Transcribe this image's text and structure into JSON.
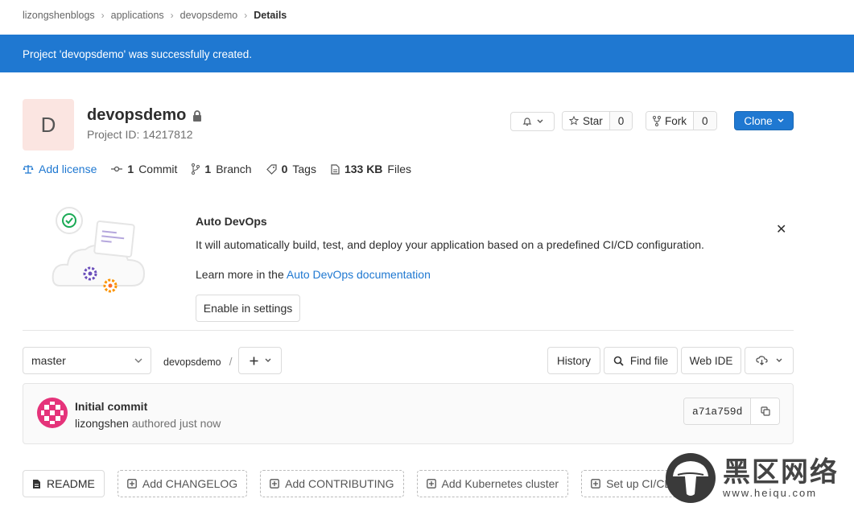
{
  "breadcrumb": {
    "items": [
      "lizongshenblogs",
      "applications",
      "devopsdemo"
    ],
    "current": "Details"
  },
  "flash": {
    "message": "Project 'devopsdemo' was successfully created."
  },
  "project": {
    "avatar_letter": "D",
    "name": "devopsdemo",
    "id_label": "Project ID: 14217812",
    "visibility_icon": "lock-icon"
  },
  "actions": {
    "star_label": "Star",
    "star_count": "0",
    "fork_label": "Fork",
    "fork_count": "0",
    "clone_label": "Clone"
  },
  "stats": {
    "add_license": "Add license",
    "commit_count": "1",
    "commit_label": "Commit",
    "branch_count": "1",
    "branch_label": "Branch",
    "tag_count": "0",
    "tag_label": "Tags",
    "files_size": "133 KB",
    "files_label": "Files"
  },
  "auto_devops": {
    "title": "Auto DevOps",
    "description": "It will automatically build, test, and deploy your application based on a predefined CI/CD configuration.",
    "learn_prefix": "Learn more in the ",
    "learn_link": "Auto DevOps documentation",
    "enable_button": "Enable in settings"
  },
  "tree": {
    "branch": "master",
    "path": "devopsdemo",
    "path_sep": "/",
    "history": "History",
    "find_file": "Find file",
    "web_ide": "Web IDE"
  },
  "commit": {
    "title": "Initial commit",
    "author": "lizongshen",
    "meta": "authored just now",
    "sha": "a71a759d"
  },
  "quick_actions": {
    "readme": "README",
    "changelog": "Add CHANGELOG",
    "contributing": "Add CONTRIBUTING",
    "kubernetes": "Add Kubernetes cluster",
    "cicd": "Set up CI/CD"
  },
  "watermark": {
    "title": "黑区网络",
    "url": "www.heiqu.com"
  },
  "colors": {
    "primary": "#1f78d1",
    "avatar_bg": "#fbe5e1",
    "border": "#dbdbdb"
  }
}
